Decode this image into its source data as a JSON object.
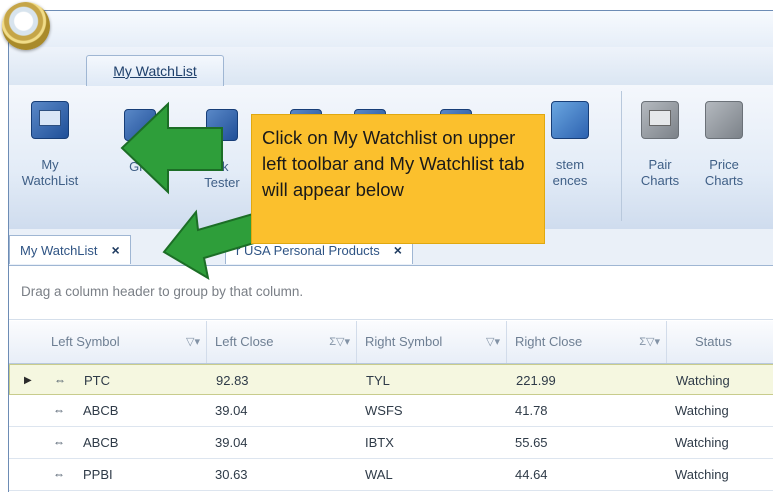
{
  "window": {
    "ribbon_tab": "My WatchList"
  },
  "ribbon": {
    "buttons": [
      {
        "label_line1": "My",
        "label_line2": "WatchList",
        "icon": "watchlist-icon"
      },
      {
        "label_line1": "",
        "label_line2": "Gro",
        "icon": "group-icon"
      },
      {
        "label_line1": "ck",
        "label_line2": "Tester",
        "icon": "backtester-icon"
      },
      {
        "label_line1": "",
        "label_line2": "",
        "icon": "scanner-icon"
      },
      {
        "label_line1": "",
        "label_line2": "",
        "icon": "portfolio-icon"
      },
      {
        "label_line1": "",
        "label_line2": "",
        "icon": "report-icon"
      },
      {
        "label_line1": "stem",
        "label_line2": "ences",
        "icon": "preferences-icon"
      },
      {
        "label_line1": "Pair",
        "label_line2": "Charts",
        "icon": "pair-charts-icon"
      },
      {
        "label_line1": "Price",
        "label_line2": "Charts",
        "icon": "price-charts-icon"
      }
    ]
  },
  "doc_tabs": [
    {
      "label": "My WatchList",
      "close": "×"
    },
    {
      "label": "r USA Personal Products",
      "close": "×"
    }
  ],
  "group_hint": "Drag a column header to group by that column.",
  "grid": {
    "columns": [
      {
        "label": "Left Symbol",
        "filter": "▽▾"
      },
      {
        "label": "Left Close",
        "filter": "Σ▽▾"
      },
      {
        "label": "Right Symbol",
        "filter": "▽▾"
      },
      {
        "label": "Right Close",
        "filter": "Σ▽▾"
      },
      {
        "label": "Status",
        "filter": "▽"
      }
    ],
    "rows": [
      {
        "left_symbol": "PTC",
        "left_close": "92.83",
        "right_symbol": "TYL",
        "right_close": "221.99",
        "status": "Watching",
        "selected": true
      },
      {
        "left_symbol": "ABCB",
        "left_close": "39.04",
        "right_symbol": "WSFS",
        "right_close": "41.78",
        "status": "Watching",
        "selected": false
      },
      {
        "left_symbol": "ABCB",
        "left_close": "39.04",
        "right_symbol": "IBTX",
        "right_close": "55.65",
        "status": "Watching",
        "selected": false
      },
      {
        "left_symbol": "PPBI",
        "left_close": "30.63",
        "right_symbol": "WAL",
        "right_close": "44.64",
        "status": "Watching",
        "selected": false
      }
    ]
  },
  "callout": {
    "text": "Click on My Watchlist on upper left toolbar and My Watchlist tab will appear below",
    "color": "#fbc02d"
  },
  "arrow_color": "#2e9e3a",
  "row_indicator": "▶",
  "row_link_icon": "link-icon"
}
